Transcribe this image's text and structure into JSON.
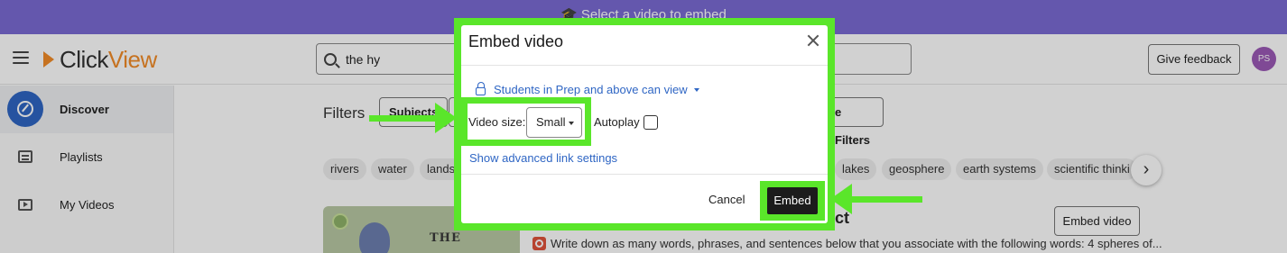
{
  "banner": {
    "icon": "graduation-cap-icon",
    "glyph": "🎓",
    "text": "Select a video to embed"
  },
  "header": {
    "logo_click": "Click",
    "logo_view": "View",
    "search": {
      "value": "the hy",
      "icon": "search-icon"
    },
    "feedback_label": "Give feedback",
    "avatar_initials": "PS"
  },
  "sidebar": {
    "items": [
      {
        "label": "Discover",
        "icon": "compass-icon",
        "active": true
      },
      {
        "label": "Playlists",
        "icon": "list-icon",
        "active": false
      },
      {
        "label": "My Videos",
        "icon": "play-icon",
        "active": false
      }
    ]
  },
  "filters": {
    "label": "Filters",
    "subjects_label": "Subjects",
    "more_filters_label": "e Filters"
  },
  "tags": [
    "rivers",
    "water",
    "landsc",
    "lakes",
    "geosphere",
    "earth systems",
    "scientific thinki"
  ],
  "tags_next": "›",
  "result": {
    "thumbnail_text": "THE",
    "title_tail": "ct",
    "description": "Write down as many words, phrases, and sentences below that you associate with the following words: 4 spheres of...",
    "embed_video_label": "Embed video"
  },
  "modal": {
    "title": "Embed video",
    "permission_text": "Students in Prep and above can view",
    "video_size_label": "Video size:",
    "video_size_value": "Small",
    "autoplay_label": "Autoplay",
    "autoplay_checked": false,
    "advanced_link": "Show advanced link settings",
    "cancel_label": "Cancel",
    "embed_label": "Embed"
  },
  "colors": {
    "banner": "#7b6bd3",
    "highlight": "#5ae62a",
    "link": "#2f66c4",
    "logo_accent": "#f28c28",
    "embed_button": "#1c1c1c"
  }
}
